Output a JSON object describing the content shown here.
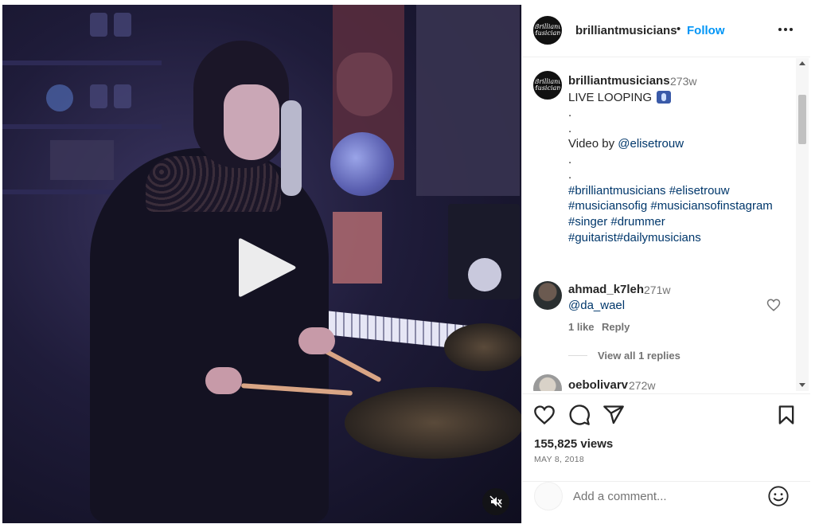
{
  "post": {
    "username": "brilliantmusicians",
    "avatar_text": "Brilliant Musicians",
    "follow_label": "Follow",
    "separator": "•"
  },
  "caption": {
    "username": "brilliantmusicians",
    "time": "273w",
    "title": "LIVE LOOPING",
    "dot1": ".",
    "dot2": ".",
    "video_by_prefix": "Video by ",
    "video_by_handle": "@elisetrouw",
    "dot3": ".",
    "dot4": ".",
    "tags_line1": "#brilliantmusicians #elisetrouw",
    "tags_line2": "#musiciansofig #musiciansofinstagram",
    "tags_line3": "#singer #drummer",
    "tags_line4": "#guitarist#dailymusicians"
  },
  "comments": [
    {
      "username": "ahmad_k7leh",
      "time": "271w",
      "text": "@da_wael",
      "likes": "1 like",
      "reply_label": "Reply",
      "view_replies": "View all 1 replies"
    },
    {
      "username": "oebolivarv",
      "time": "272w"
    }
  ],
  "stats": {
    "views": "155,825 views",
    "date": "MAY 8, 2018"
  },
  "comment_box": {
    "placeholder": "Add a comment..."
  },
  "icons": [
    "more-icon",
    "heart-icon",
    "comment-icon",
    "share-icon",
    "bookmark-icon",
    "play-icon",
    "mute-icon",
    "emoji-icon"
  ],
  "colors": {
    "link": "#00376b",
    "follow": "#0095f6",
    "muted": "#737373",
    "text": "#262626"
  }
}
